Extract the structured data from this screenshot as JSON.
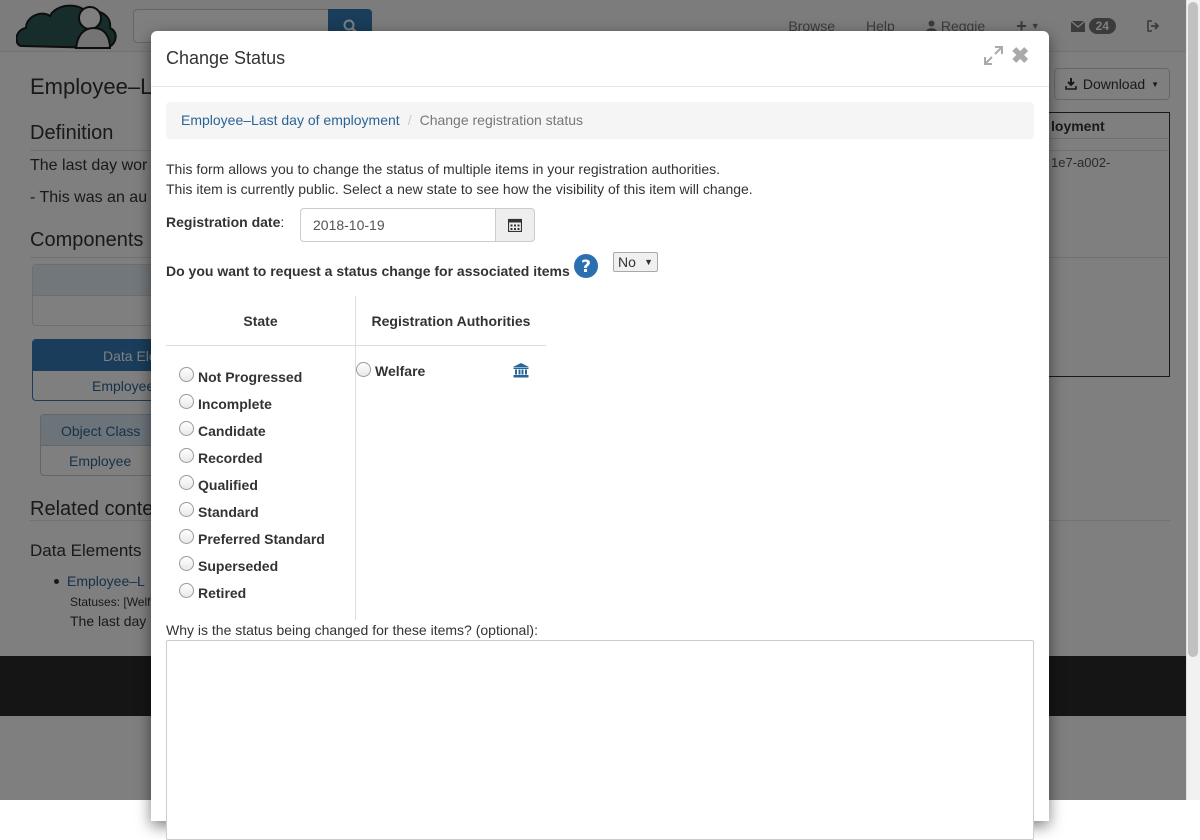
{
  "navbar": {
    "search": {
      "placeholder": "",
      "value": ""
    },
    "links": {
      "browse": "Browse",
      "help": "Help",
      "user": "Reggie"
    },
    "messages_count": "24"
  },
  "background": {
    "title": "Employee–L",
    "definition_heading": "Definition",
    "definition_text_1": "The last day wor",
    "definition_text_2": "- This was an au",
    "components_heading": "Components",
    "data_element_label": "Data Ele",
    "data_element_value": "Employee",
    "object_class_label": "Object Class",
    "object_class_value": "Employee",
    "related_heading": "Related conte",
    "data_elements_heading": "Data Elements",
    "related_item_link": "Employee–L",
    "related_item_status": "Statuses: [Welf",
    "related_item_desc": "The last day",
    "download_button": "Download",
    "side_panel_head": "loyment",
    "side_panel_text": "1e7-a002-"
  },
  "modal": {
    "title": "Change Status",
    "breadcrumb": [
      {
        "label": "Employee–Last day of employment"
      },
      {
        "label": "Change registration status"
      }
    ],
    "intro_line_1": "This form allows you to change the status of multiple items in your registration authorities.",
    "intro_line_2": "This item is currently public. Select a new state to see how the visibility of this item will change.",
    "registration_date_label": "Registration date",
    "registration_date_value": "2018-10-19",
    "associated_label": "Do you want to request a status change for associated items",
    "associated_value": "No",
    "table": {
      "state_header": "State",
      "ra_header": "Registration Authorities",
      "states": [
        "Not Progressed",
        "Incomplete",
        "Candidate",
        "Recorded",
        "Qualified",
        "Standard",
        "Preferred Standard",
        "Superseded",
        "Retired"
      ],
      "authorities": [
        "Welfare"
      ]
    },
    "reason_label": "Why is the status being changed for these items? (optional):",
    "reason_value": ""
  }
}
